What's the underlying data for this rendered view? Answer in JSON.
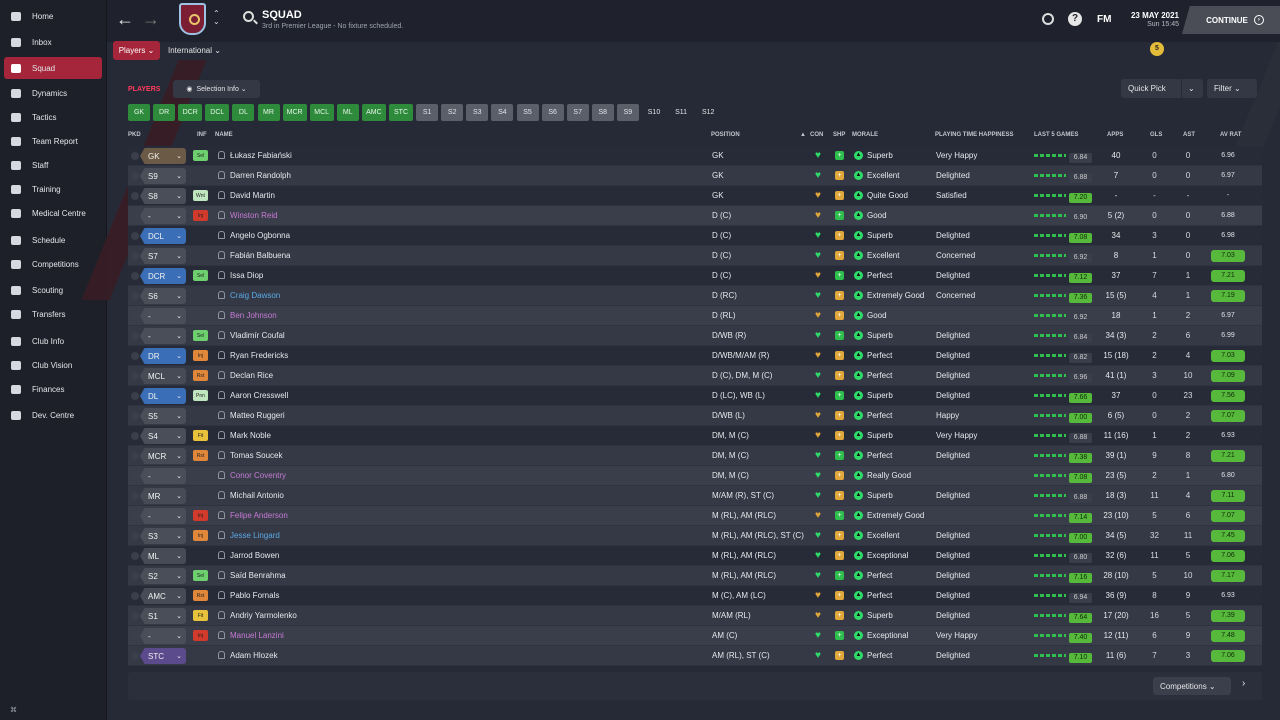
{
  "sidebar": {
    "items": [
      {
        "label": "Home",
        "icon": "home-icon",
        "active": false
      },
      {
        "label": "Inbox",
        "icon": "inbox-icon",
        "active": false
      },
      {
        "label": "Squad",
        "icon": "shirt-icon",
        "active": true
      },
      {
        "label": "Dynamics",
        "icon": "dynamics-icon",
        "active": false
      },
      {
        "label": "Tactics",
        "icon": "tactics-icon",
        "active": false
      },
      {
        "label": "Team Report",
        "icon": "report-icon",
        "active": false
      },
      {
        "label": "Staff",
        "icon": "staff-icon",
        "active": false
      },
      {
        "label": "Training",
        "icon": "training-icon",
        "active": false
      },
      {
        "label": "Medical Centre",
        "icon": "medical-icon",
        "active": false
      },
      {
        "label": "Schedule",
        "icon": "calendar-icon",
        "active": false
      },
      {
        "label": "Competitions",
        "icon": "trophy-icon",
        "active": false
      },
      {
        "label": "Scouting",
        "icon": "scouting-icon",
        "active": false
      },
      {
        "label": "Transfers",
        "icon": "transfers-icon",
        "active": false
      },
      {
        "label": "Club Info",
        "icon": "shield-icon",
        "active": false
      },
      {
        "label": "Club Vision",
        "icon": "vision-icon",
        "active": false
      },
      {
        "label": "Finances",
        "icon": "finances-icon",
        "active": false
      },
      {
        "label": "Dev. Centre",
        "icon": "dev-icon",
        "active": false
      }
    ],
    "bottom_icon": "⌘"
  },
  "header": {
    "title": "SQUAD",
    "subtitle": "3rd in Premier League - No fixture scheduled.",
    "fm": "FM",
    "date": "23 MAY 2021",
    "time": "Sun 15:45",
    "continue": "CONTINUE",
    "notifications": "5"
  },
  "tabs": {
    "players": "Players ⌄",
    "international": "International ⌄"
  },
  "section": {
    "title": "PLAYERS",
    "selection_info": "Selection Info ⌄",
    "quick_pick": "Quick Pick",
    "filter": "Filter ⌄"
  },
  "position_buttons": [
    {
      "label": "GK",
      "style": "green"
    },
    {
      "label": "DR",
      "style": "green"
    },
    {
      "label": "DCR",
      "style": "green"
    },
    {
      "label": "DCL",
      "style": "green"
    },
    {
      "label": "DL",
      "style": "green"
    },
    {
      "label": "MR",
      "style": "green"
    },
    {
      "label": "MCR",
      "style": "green"
    },
    {
      "label": "MCL",
      "style": "green"
    },
    {
      "label": "ML",
      "style": "green"
    },
    {
      "label": "AMC",
      "style": "green"
    },
    {
      "label": "STC",
      "style": "green"
    },
    {
      "label": "S1",
      "style": "grey"
    },
    {
      "label": "S2",
      "style": "grey"
    },
    {
      "label": "S3",
      "style": "grey"
    },
    {
      "label": "S4",
      "style": "grey"
    },
    {
      "label": "S5",
      "style": "grey"
    },
    {
      "label": "S6",
      "style": "grey"
    },
    {
      "label": "S7",
      "style": "grey"
    },
    {
      "label": "S8",
      "style": "grey"
    },
    {
      "label": "S9",
      "style": "grey"
    },
    {
      "label": "S10",
      "style": "plain"
    },
    {
      "label": "S11",
      "style": "plain"
    },
    {
      "label": "S12",
      "style": "plain"
    }
  ],
  "columns": {
    "pkd": "PKD",
    "inf": "INF",
    "name": "NAME",
    "position": "POSITION",
    "con": "CON",
    "shp": "SHP",
    "morale": "MORALE",
    "pth": "PLAYING TIME HAPPINESS",
    "last5": "LAST 5 GAMES",
    "apps": "APPS",
    "gls": "GLS",
    "ast": "AST",
    "avrat": "AV RAT"
  },
  "players": [
    {
      "role": "GK",
      "inf": "Sel",
      "name": "Łukasz Fabiański",
      "pos": "GK",
      "morale": "Superb",
      "pth": "Very Happy",
      "form": "6.84",
      "apps": "40",
      "gls": "0",
      "ast": "0",
      "avrat": "6.96"
    },
    {
      "role": "S9",
      "inf": "",
      "name": "Darren Randolph",
      "pos": "GK",
      "morale": "Excellent",
      "pth": "Delighted",
      "form": "6.88",
      "apps": "7",
      "gls": "0",
      "ast": "0",
      "avrat": "6.97"
    },
    {
      "role": "S8",
      "inf": "Wnt",
      "name": "David Martin",
      "pos": "GK",
      "morale": "Quite Good",
      "pth": "Satisfied",
      "form": "7.20",
      "apps": "-",
      "gls": "-",
      "ast": "-",
      "avrat": "-"
    },
    {
      "role": "-",
      "inf": "Inj",
      "name": "Winston Reid",
      "pos": "D (C)",
      "morale": "Good",
      "pth": "",
      "form": "6.90",
      "apps": "5 (2)",
      "gls": "0",
      "ast": "0",
      "avrat": "6.88"
    },
    {
      "role": "DCL",
      "inf": "",
      "name": "Angelo Ogbonna",
      "pos": "D (C)",
      "morale": "Superb",
      "pth": "Delighted",
      "form": "7.08",
      "apps": "34",
      "gls": "3",
      "ast": "0",
      "avrat": "6.98"
    },
    {
      "role": "S7",
      "inf": "",
      "name": "Fabián Balbuena",
      "pos": "D (C)",
      "morale": "Excellent",
      "pth": "Concerned",
      "form": "6.92",
      "apps": "8",
      "gls": "1",
      "ast": "0",
      "avrat": "7.03"
    },
    {
      "role": "DCR",
      "inf": "Sel",
      "name": "Issa Diop",
      "pos": "D (C)",
      "morale": "Perfect",
      "pth": "Delighted",
      "form": "7.12",
      "apps": "37",
      "gls": "7",
      "ast": "1",
      "avrat": "7.21"
    },
    {
      "role": "S6",
      "inf": "",
      "name": "Craig Dawson",
      "pos": "D (RC)",
      "morale": "Extremely Good",
      "pth": "Concerned",
      "form": "7.36",
      "apps": "15 (5)",
      "gls": "4",
      "ast": "1",
      "avrat": "7.19"
    },
    {
      "role": "-",
      "inf": "",
      "name": "Ben Johnson",
      "pos": "D (RL)",
      "morale": "Good",
      "pth": "",
      "form": "6.92",
      "apps": "18",
      "gls": "1",
      "ast": "2",
      "avrat": "6.97"
    },
    {
      "role": "-",
      "inf": "Sel",
      "name": "Vladimír Coufal",
      "pos": "D/WB (R)",
      "morale": "Superb",
      "pth": "Delighted",
      "form": "6.84",
      "apps": "34 (3)",
      "gls": "2",
      "ast": "6",
      "avrat": "6.99"
    },
    {
      "role": "DR",
      "inf": "Inj",
      "name": "Ryan Fredericks",
      "pos": "D/WB/M/AM (R)",
      "morale": "Perfect",
      "pth": "Delighted",
      "form": "6.82",
      "apps": "15 (18)",
      "gls": "2",
      "ast": "4",
      "avrat": "7.03"
    },
    {
      "role": "MCL",
      "inf": "Rst",
      "name": "Declan Rice",
      "pos": "D (C), DM, M (C)",
      "morale": "Perfect",
      "pth": "Delighted",
      "form": "6.96",
      "apps": "41 (1)",
      "gls": "3",
      "ast": "10",
      "avrat": "7.09"
    },
    {
      "role": "DL",
      "inf": "Pnn",
      "name": "Aaron Cresswell",
      "pos": "D (LC), WB (L)",
      "morale": "Superb",
      "pth": "Delighted",
      "form": "7.66",
      "apps": "37",
      "gls": "0",
      "ast": "23",
      "avrat": "7.56"
    },
    {
      "role": "S5",
      "inf": "",
      "name": "Matteo Ruggeri",
      "pos": "D/WB (L)",
      "morale": "Perfect",
      "pth": "Happy",
      "form": "7.00",
      "apps": "6 (5)",
      "gls": "0",
      "ast": "2",
      "avrat": "7.07"
    },
    {
      "role": "S4",
      "inf": "Fit",
      "name": "Mark Noble",
      "pos": "DM, M (C)",
      "morale": "Superb",
      "pth": "Very Happy",
      "form": "6.88",
      "apps": "11 (16)",
      "gls": "1",
      "ast": "2",
      "avrat": "6.93"
    },
    {
      "role": "MCR",
      "inf": "Rst",
      "name": "Tomas Soucek",
      "pos": "DM, M (C)",
      "morale": "Perfect",
      "pth": "Delighted",
      "form": "7.38",
      "apps": "39 (1)",
      "gls": "9",
      "ast": "8",
      "avrat": "7.21"
    },
    {
      "role": "-",
      "inf": "",
      "name": "Conor Coventry",
      "pos": "DM, M (C)",
      "morale": "Really Good",
      "pth": "",
      "form": "7.08",
      "apps": "23 (5)",
      "gls": "2",
      "ast": "1",
      "avrat": "6.80"
    },
    {
      "role": "MR",
      "inf": "",
      "name": "Michail Antonio",
      "pos": "M/AM (R), ST (C)",
      "morale": "Superb",
      "pth": "Delighted",
      "form": "6.88",
      "apps": "18 (3)",
      "gls": "11",
      "ast": "4",
      "avrat": "7.11"
    },
    {
      "role": "-",
      "inf": "Inj",
      "name": "Felipe Anderson",
      "pos": "M (RL), AM (RLC)",
      "morale": "Extremely Good",
      "pth": "",
      "form": "7.14",
      "apps": "23 (10)",
      "gls": "5",
      "ast": "6",
      "avrat": "7.07"
    },
    {
      "role": "S3",
      "inf": "Inj",
      "name": "Jesse Lingard",
      "pos": "M (RL), AM (RLC), ST (C)",
      "morale": "Excellent",
      "pth": "Delighted",
      "form": "7.00",
      "apps": "34 (5)",
      "gls": "32",
      "ast": "11",
      "avrat": "7.45"
    },
    {
      "role": "ML",
      "inf": "",
      "name": "Jarrod Bowen",
      "pos": "M (RL), AM (RLC)",
      "morale": "Exceptional",
      "pth": "Delighted",
      "form": "6.80",
      "apps": "32 (6)",
      "gls": "11",
      "ast": "5",
      "avrat": "7.06"
    },
    {
      "role": "S2",
      "inf": "Sel",
      "name": "Saïd Benrahma",
      "pos": "M (RL), AM (RLC)",
      "morale": "Perfect",
      "pth": "Delighted",
      "form": "7.16",
      "apps": "28 (10)",
      "gls": "5",
      "ast": "10",
      "avrat": "7.17"
    },
    {
      "role": "AMC",
      "inf": "Rst",
      "name": "Pablo Fornals",
      "pos": "M (C), AM (LC)",
      "morale": "Perfect",
      "pth": "Delighted",
      "form": "6.94",
      "apps": "36 (9)",
      "gls": "8",
      "ast": "9",
      "avrat": "6.93"
    },
    {
      "role": "S1",
      "inf": "Fit",
      "name": "Andriy Yarmolenko",
      "pos": "M/AM (RL)",
      "morale": "Superb",
      "pth": "Delighted",
      "form": "7.64",
      "apps": "17 (20)",
      "gls": "16",
      "ast": "5",
      "avrat": "7.39"
    },
    {
      "role": "-",
      "inf": "Inj",
      "name": "Manuel Lanzini",
      "pos": "AM (C)",
      "morale": "Exceptional",
      "pth": "Very Happy",
      "form": "7.40",
      "apps": "12 (11)",
      "gls": "6",
      "ast": "9",
      "avrat": "7.48"
    },
    {
      "role": "STC",
      "inf": "",
      "name": "Adam Hlozek",
      "pos": "AM (RL), ST (C)",
      "morale": "Perfect",
      "pth": "Delighted",
      "form": "7.10",
      "apps": "11 (6)",
      "gls": "7",
      "ast": "3",
      "avrat": "7.06"
    }
  ],
  "footer": {
    "competitions": "Competitions ⌄",
    "next": "›"
  },
  "colors": {
    "accent": "#a5253a",
    "green": "#2e8b3c",
    "good_rating": "#56b93b"
  }
}
